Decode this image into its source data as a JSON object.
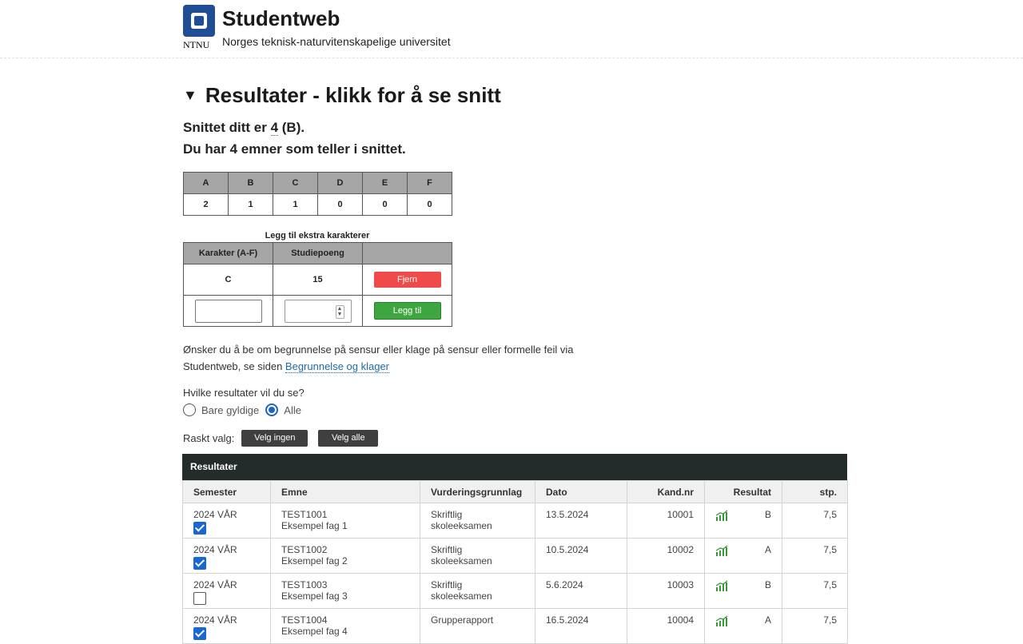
{
  "header": {
    "app_title": "Studentweb",
    "logo_text": "NTNU",
    "subtitle": "Norges teknisk-naturvitenskapelige universitet"
  },
  "section": {
    "title": "Resultater - klikk for å se snitt",
    "snitt_prefix": "Snittet ditt er ",
    "snitt_value": "4",
    "snitt_mid": " (",
    "snitt_letter": "B",
    "snitt_suffix": ").",
    "count_prefix": "Du har ",
    "count_value": "4",
    "count_suffix": " emner som teller i snittet."
  },
  "grade_distribution": {
    "headers": [
      "A",
      "B",
      "C",
      "D",
      "E",
      "F"
    ],
    "counts": [
      "2",
      "1",
      "1",
      "0",
      "0",
      "0"
    ]
  },
  "extra_grades": {
    "caption": "Legg til ekstra karakterer",
    "col_grade": "Karakter (A-F)",
    "col_points": "Studiepoeng",
    "row_grade": "C",
    "row_points": "15",
    "remove_label": "Fjern",
    "add_label": "Legg til"
  },
  "info": {
    "text1": "Ønsker du å be om begrunnelse på sensur eller klage på sensur eller formelle feil via",
    "text2": "Studentweb, se siden ",
    "link": "Begrunnelse og klager"
  },
  "filter": {
    "question": "Hvilke resultater vil du se?",
    "opt_valid": "Bare gyldige",
    "opt_all": "Alle",
    "selected": "Alle"
  },
  "quick": {
    "label": "Raskt valg:",
    "none": "Velg ingen",
    "all": "Velg alle"
  },
  "results": {
    "title": "Resultater",
    "columns": [
      "Semester",
      "Emne",
      "Vurderingsgrunnlag",
      "Dato",
      "Kand.nr",
      "Resultat",
      "stp."
    ],
    "rows": [
      {
        "semester": "2024 VÅR",
        "checked": true,
        "code": "TEST1001",
        "name": "Eksempel fag 1",
        "basis": "Skriftlig skoleeksamen",
        "date": "13.5.2024",
        "cand": "10001",
        "grade": "B",
        "stp": "7,5"
      },
      {
        "semester": "2024 VÅR",
        "checked": true,
        "code": "TEST1002",
        "name": "Eksempel fag 2",
        "basis": "Skriftlig skoleeksamen",
        "date": "10.5.2024",
        "cand": "10002",
        "grade": "A",
        "stp": "7,5"
      },
      {
        "semester": "2024 VÅR",
        "checked": false,
        "code": "TEST1003",
        "name": "Eksempel fag 3",
        "basis": "Skriftlig skoleeksamen",
        "date": "5.6.2024",
        "cand": "10003",
        "grade": "B",
        "stp": "7,5"
      },
      {
        "semester": "2024 VÅR",
        "checked": true,
        "code": "TEST1004",
        "name": "Eksempel fag 4",
        "basis": "Grupperapport",
        "date": "16.5.2024",
        "cand": "10004",
        "grade": "A",
        "stp": "7,5"
      }
    ]
  },
  "colors": {
    "accent": "#1e6aa8",
    "remove": "#f04a4a",
    "add": "#3ea63e",
    "results_header": "#232b2b",
    "checkbox": "#1a66d2",
    "chart_icon": "#3a9a3a"
  },
  "icons": {
    "logo": "ntnu-logo-icon",
    "stats": "bar-chart-trend-icon",
    "collapse": "triangle-down-icon"
  }
}
